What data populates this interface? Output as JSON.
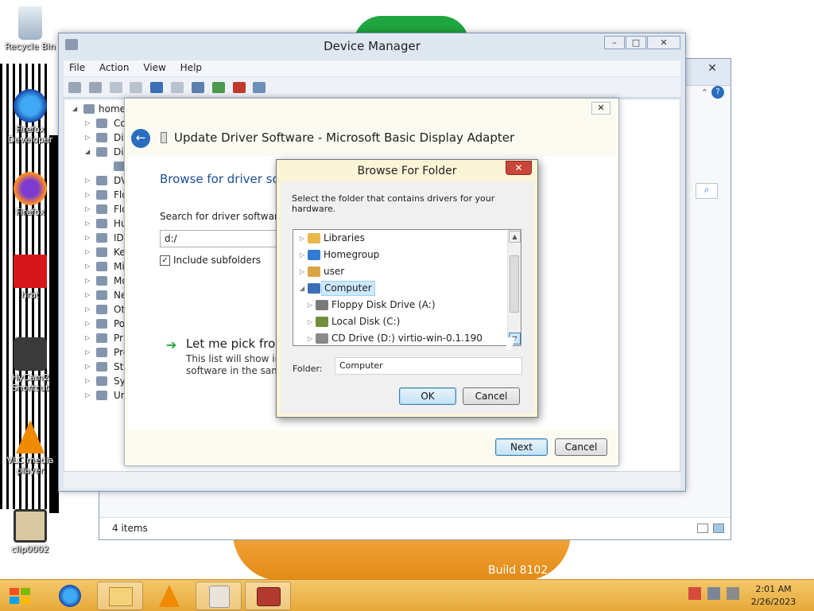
{
  "desktop": {
    "icons": [
      {
        "label": "Recycle Bin"
      },
      {
        "label": "Firefox Developer"
      },
      {
        "label": "Firefox"
      },
      {
        "label": "hrat"
      },
      {
        "label": "HyCam2 Shortcut"
      },
      {
        "label": "VLC media player"
      },
      {
        "label": "clip0002"
      }
    ],
    "build_text": "Build 8102"
  },
  "explorer": {
    "status": "4 items",
    "close": "✕"
  },
  "device_manager": {
    "title": "Device Manager",
    "menu": [
      "File",
      "Action",
      "View",
      "Help"
    ],
    "tree_root": "home",
    "tree_items": [
      "Co",
      "Di",
      "Dis",
      "",
      "DV",
      "Flo",
      "Flo",
      "Hu",
      "IDI",
      "Ke",
      "Mi",
      "Mo",
      "Ne",
      "Ot",
      "Po",
      "Pri",
      "Pro",
      "Sto",
      "Sys",
      "Uni"
    ]
  },
  "wizard": {
    "title": "Update Driver Software - Microsoft Basic Display Adapter",
    "heading": "Browse for driver sof",
    "search_label": "Search for driver software in",
    "path_value": "d:/",
    "include_subfolders": "Include subfolders",
    "pick_title": "Let me pick from",
    "pick_desc_1": "This list will show inst",
    "pick_desc_2": "software in the same c",
    "next": "Next",
    "cancel": "Cancel"
  },
  "browse_dialog": {
    "title": "Browse For Folder",
    "instruction": "Select the folder that contains drivers for your hardware.",
    "items": [
      {
        "label": "Libraries",
        "color": "#e8b84a"
      },
      {
        "label": "Homegroup",
        "color": "#2f7bd6"
      },
      {
        "label": "user",
        "color": "#d9a441"
      },
      {
        "label": "Computer",
        "color": "#3b6fb6"
      },
      {
        "label": "Floppy Disk Drive (A:)",
        "color": "#7a7a7a"
      },
      {
        "label": "Local Disk (C:)",
        "color": "#6f8f3a"
      },
      {
        "label": "CD Drive (D:) virtio-win-0.1.190",
        "color": "#8a8a8a"
      }
    ],
    "folder_label": "Folder:",
    "folder_value": "Computer",
    "ok": "OK",
    "cancel": "Cancel",
    "close": "✕"
  },
  "taskbar": {
    "time": "2:01 AM",
    "date": "2/26/2023"
  }
}
